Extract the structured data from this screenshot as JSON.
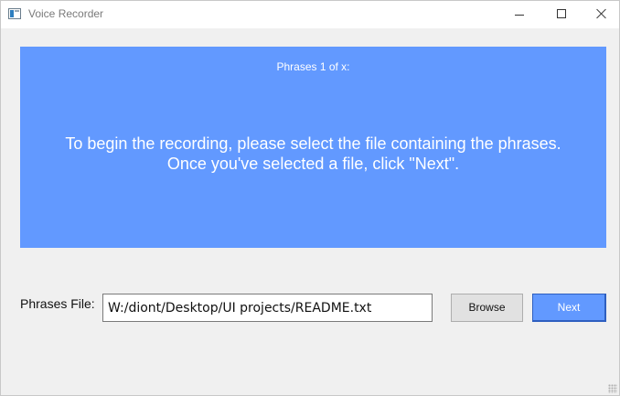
{
  "window": {
    "title": "Voice Recorder",
    "controls": {
      "minimize_icon": "minimize-icon",
      "maximize_icon": "maximize-icon",
      "close_icon": "close-icon"
    }
  },
  "panel": {
    "background": "#6299ff",
    "phrase_counter": "Phrases 1 of x:",
    "instructions_line1": "To begin the recording, please select the file containing the phrases.",
    "instructions_line2": "Once you've selected a file, click \"Next\"."
  },
  "file_selector": {
    "label": "Phrases File:",
    "value": "W:/diont/Desktop/UI projects/README.txt"
  },
  "buttons": {
    "browse_label": "Browse",
    "next_label": "Next"
  },
  "colors": {
    "accent": "#6299ff",
    "window_bg": "#f0f0f0"
  }
}
